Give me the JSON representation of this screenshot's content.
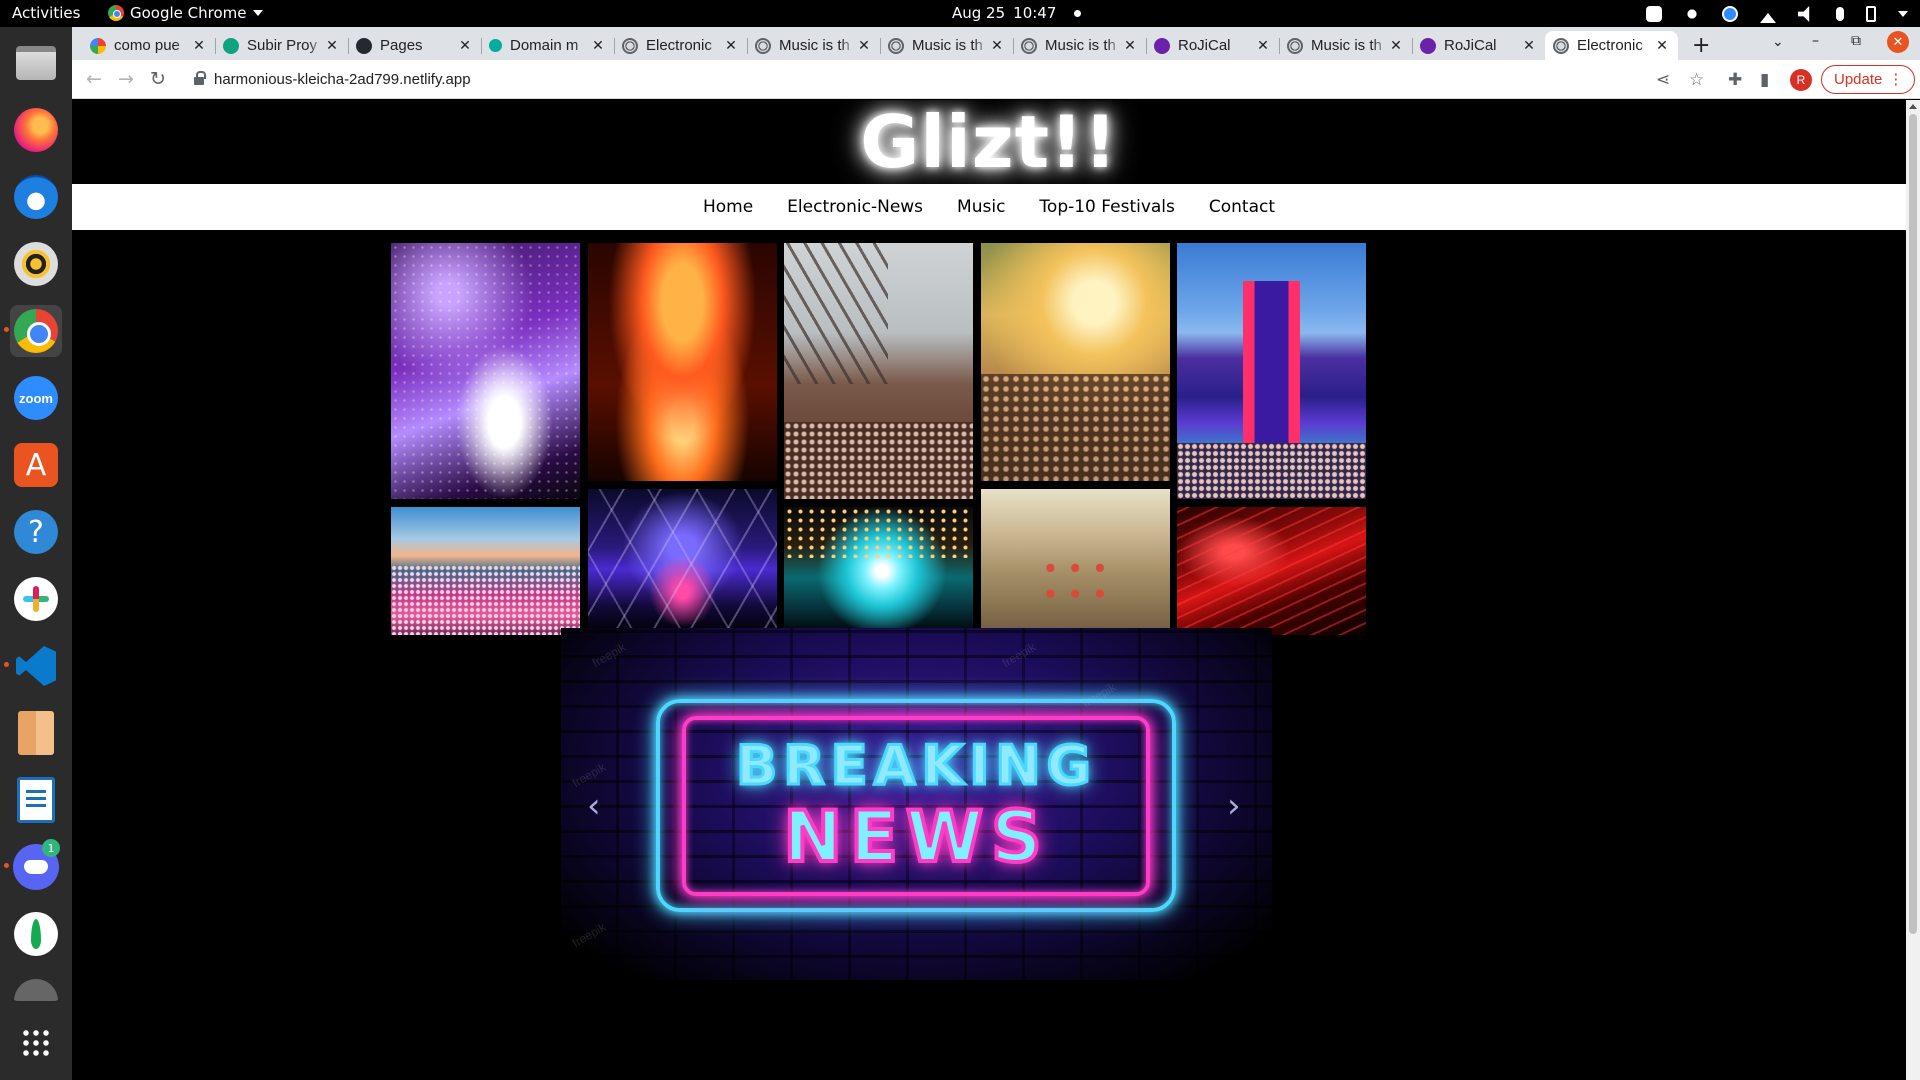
{
  "topbar": {
    "activities": "Activities",
    "app_menu": "Google Chrome",
    "date": "Aug 25",
    "time": "10:47"
  },
  "dock": {
    "items": [
      "Files",
      "Firefox",
      "Thunderbird",
      "Rhythmbox",
      "Google Chrome",
      "Zoom",
      "Ubuntu Software",
      "Help",
      "Slack",
      "Visual Studio Code",
      "Archive Manager",
      "LibreOffice Writer",
      "Discord",
      "MongoDB Compass",
      "Show Applications"
    ],
    "zoom_label": "zoom",
    "discord_badge": "1"
  },
  "tabs": [
    {
      "title": "como pue",
      "favicon": "google"
    },
    {
      "title": "Subir Proy",
      "favicon": "chatgpt"
    },
    {
      "title": "Pages",
      "favicon": "github"
    },
    {
      "title": "Domain m",
      "favicon": "domain"
    },
    {
      "title": "Electronic",
      "favicon": "globe"
    },
    {
      "title": "Music is th",
      "favicon": "globe"
    },
    {
      "title": "Music is th",
      "favicon": "globe"
    },
    {
      "title": "Music is th",
      "favicon": "globe"
    },
    {
      "title": "RoJiCal",
      "favicon": "rojical"
    },
    {
      "title": "Music is th",
      "favicon": "globe"
    },
    {
      "title": "RoJiCal",
      "favicon": "rojical"
    },
    {
      "title": "Electronic",
      "favicon": "globe",
      "active": true
    }
  ],
  "toolbar": {
    "url": "harmonious-kleicha-2ad799.netlify.app",
    "profile_initial": "R",
    "update_label": "Update"
  },
  "site": {
    "logo": "Glizt!!",
    "nav": [
      "Home",
      "Electronic-News",
      "Music",
      "Top-10 Festivals",
      "Contact"
    ],
    "gallery": [
      {
        "name": "confetti-crowd-photo"
      },
      {
        "name": "fireworks-stage-photo"
      },
      {
        "name": "industrial-festival-photo"
      },
      {
        "name": "sunset-crowd-photo"
      },
      {
        "name": "mainstage-photo"
      },
      {
        "name": "festival-field-photo"
      },
      {
        "name": "laser-stage-photo"
      },
      {
        "name": "cyan-light-crowd-photo"
      },
      {
        "name": "aerial-tents-photo"
      },
      {
        "name": "red-laser-photo"
      }
    ],
    "carousel": {
      "line1": "BREAKING",
      "line2": "NEWS",
      "prev": "‹",
      "next": "›",
      "watermark": "freepik"
    }
  },
  "colors": {
    "accent_neon_cyan": "#4cd9ff",
    "accent_neon_pink": "#ff3cc8",
    "chrome_update_red": "#d93025",
    "ubuntu_orange": "#e95420"
  }
}
